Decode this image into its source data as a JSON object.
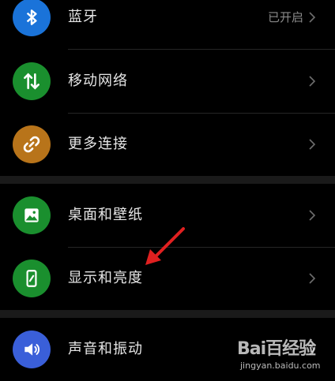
{
  "settings": {
    "items": [
      {
        "label": "蓝牙",
        "status": "已开启",
        "icon": "bluetooth-icon",
        "color": "#1a73d9"
      },
      {
        "label": "移动网络",
        "status": "",
        "icon": "mobile-data-icon",
        "color": "#1a8f2e"
      },
      {
        "label": "更多连接",
        "status": "",
        "icon": "link-icon",
        "color": "#b8741a"
      },
      {
        "label": "桌面和壁纸",
        "status": "",
        "icon": "wallpaper-icon",
        "color": "#1a8f2e"
      },
      {
        "label": "显示和亮度",
        "status": "",
        "icon": "display-brightness-icon",
        "color": "#1a8f2e"
      },
      {
        "label": "声音和振动",
        "status": "",
        "icon": "sound-icon",
        "color": "#3a5fd9"
      }
    ]
  },
  "watermark": {
    "main": "Bai百经验",
    "sub": "jingyan.baidu.com"
  },
  "colors": {
    "background": "#000000",
    "arrow": "#e02020"
  }
}
